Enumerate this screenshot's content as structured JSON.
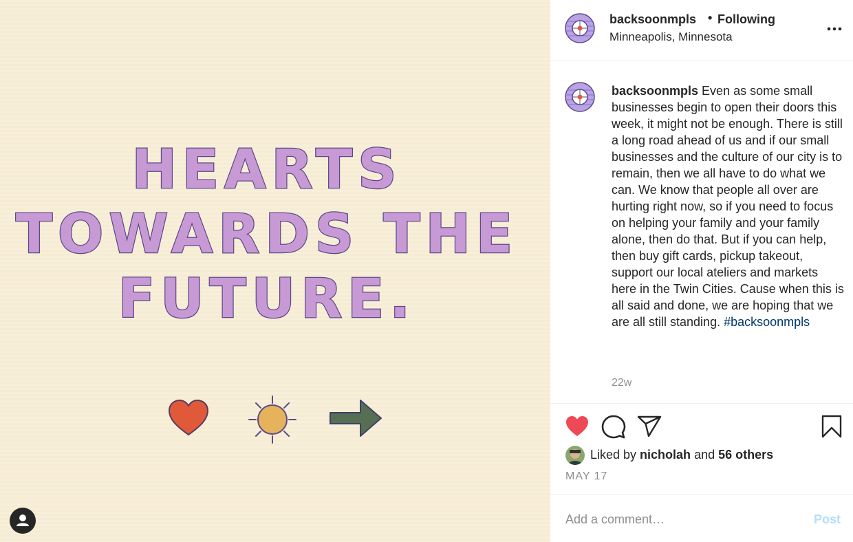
{
  "post_image": {
    "headline_lines": [
      "HEARTS",
      "TOWARDS THE",
      "FUTURE."
    ],
    "icons": [
      "heart-icon",
      "sun-icon",
      "arrow-right-icon"
    ],
    "tag_icon": "user-tag-icon"
  },
  "header": {
    "username": "backsoonmpls",
    "separator": "•",
    "follow_status": "Following",
    "location": "Minneapolis, Minnesota",
    "more_icon": "more-options-icon"
  },
  "caption": {
    "username": "backsoonmpls",
    "text": " Even as some small businesses begin to open their doors this week, it might not be enough. There is still a long road ahead of us and if our small businesses and the culture of our city is to remain, then we all have to do what we can. We know that people all over are hurting right now, so if you need to focus on helping your family and your family alone, then do that. But if you can help, then buy gift cards, pickup takeout, support our local ateliers and markets here in the Twin Cities. Cause when this is all said and done, we are hoping that we are all still standing. ",
    "hashtag": "#backsoonmpls",
    "age": "22w"
  },
  "actions": {
    "icons": [
      "heart-filled-icon",
      "comment-icon",
      "share-icon",
      "bookmark-icon"
    ],
    "liked_color": "#ed4956"
  },
  "likes": {
    "prefix": "Liked by ",
    "user": "nicholah",
    "middle": " and ",
    "others": "56 others"
  },
  "date": "MAY 17",
  "comment_box": {
    "placeholder": "Add a comment…",
    "post_label": "Post"
  }
}
